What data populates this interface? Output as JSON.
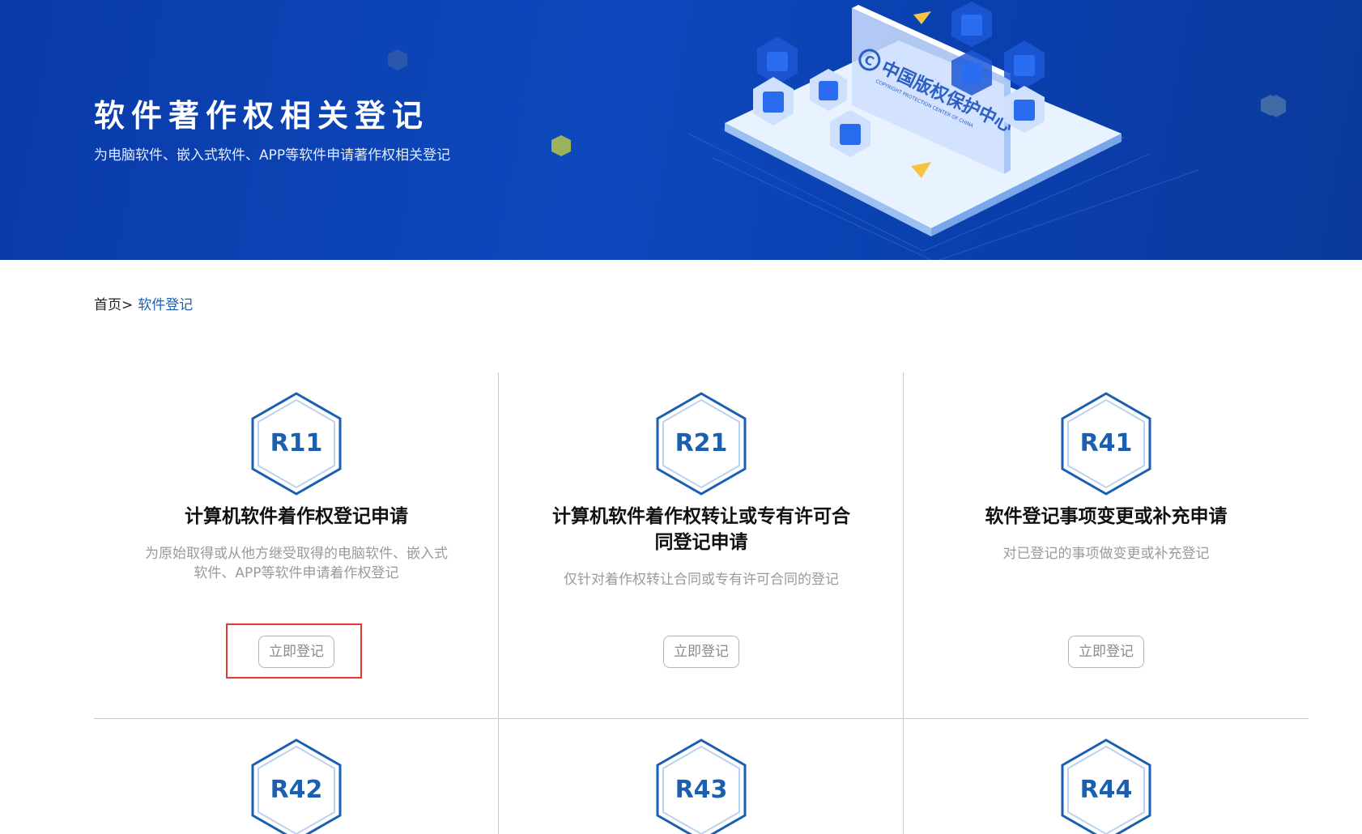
{
  "banner": {
    "title": "软件著作权相关登记",
    "subtitle": "为电脑软件、嵌入式软件、APP等软件申请著作权相关登记",
    "logo_text": "中国版权保护中心",
    "logo_subtext": "COPYRIGHT PROTECTION CENTER OF CHINA"
  },
  "breadcrumb": {
    "home": "首页",
    "separator": ">",
    "current": "软件登记"
  },
  "colors": {
    "banner_bg": "#0d49bd",
    "accent": "#1d5fb4",
    "hex_border": "#1a5fb0",
    "highlight": "#e53935"
  },
  "cards": [
    {
      "code": "R11",
      "title": "计算机软件着作权登记申请",
      "desc": "为原始取得或从他方继受取得的电脑软件、嵌入式软件、APP等软件申请着作权登记",
      "button": "立即登记"
    },
    {
      "code": "R21",
      "title": "计算机软件着作权转让或专有许可合同登记申请",
      "desc": "仅针对着作权转让合同或专有许可合同的登记",
      "button": "立即登记"
    },
    {
      "code": "R41",
      "title": "软件登记事项变更或补充申请",
      "desc": "对已登记的事项做变更或补充登记",
      "button": "立即登记"
    },
    {
      "code": "R42"
    },
    {
      "code": "R43"
    },
    {
      "code": "R44"
    }
  ]
}
